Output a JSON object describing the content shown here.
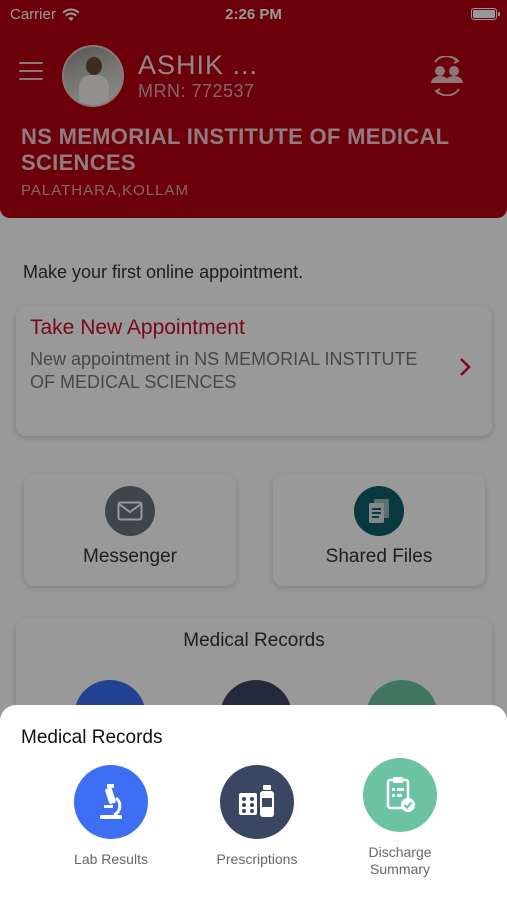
{
  "status_bar": {
    "carrier": "Carrier",
    "time": "2:26 PM"
  },
  "header": {
    "user_name": "ASHIK ...",
    "mrn": "MRN: 772537",
    "hospital_name": "NS MEMORIAL INSTITUTE OF MEDICAL SCIENCES",
    "hospital_location": "PALATHARA,KOLLAM"
  },
  "main": {
    "intro_text": "Make your first online appointment.",
    "appointment_card": {
      "title": "Take New Appointment",
      "subtitle": "New appointment in NS MEMORIAL INSTITUTE OF MEDICAL SCIENCES"
    },
    "tiles": {
      "messenger": "Messenger",
      "shared_files": "Shared Files"
    },
    "records_section_title": "Medical Records"
  },
  "bottom_sheet": {
    "title": "Medical Records",
    "items": [
      {
        "label": "Lab Results",
        "icon": "microscope-icon",
        "color": "#3d6ef3"
      },
      {
        "label": "Prescriptions",
        "icon": "medicine-icon",
        "color": "#3b4663"
      },
      {
        "label": "Discharge Summary",
        "icon": "clipboard-check-icon",
        "color": "#6cc3a4"
      }
    ]
  },
  "colors": {
    "brand": "#b30012",
    "accent_text": "#c8102e"
  }
}
